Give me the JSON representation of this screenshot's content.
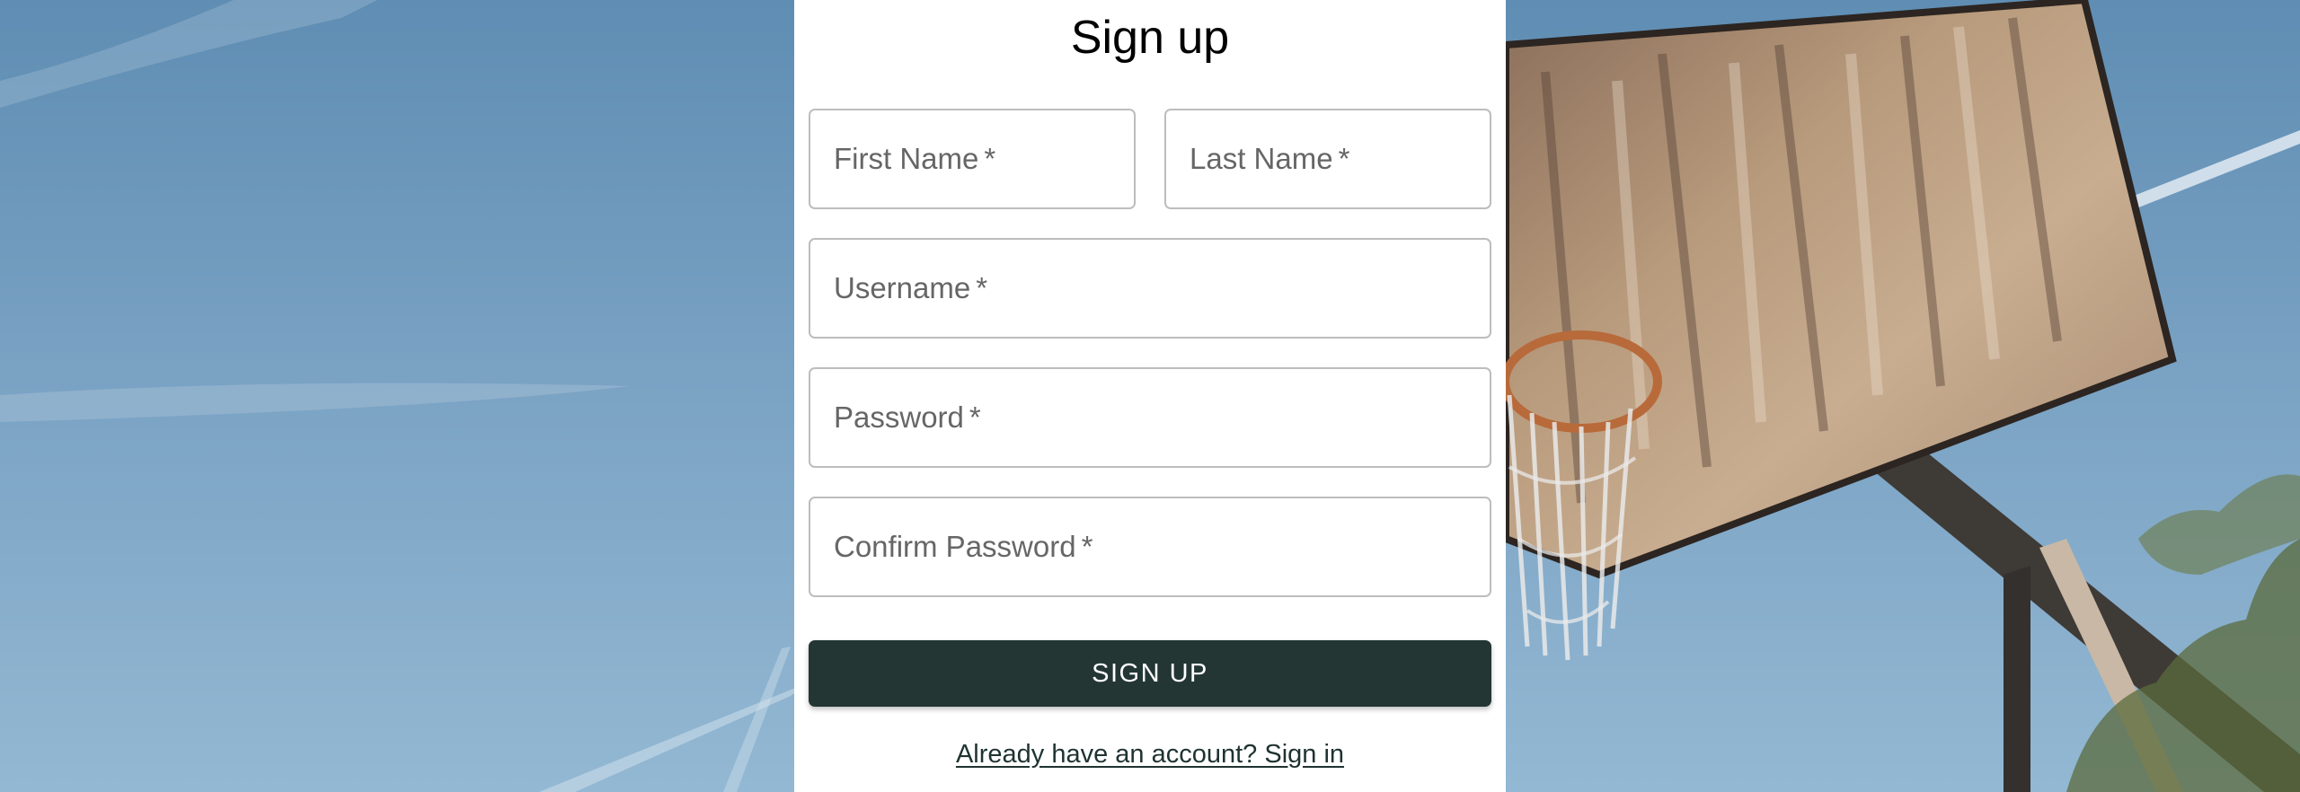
{
  "form": {
    "title": "Sign up",
    "fields": {
      "first_name": {
        "label": "First Name",
        "required_mark": "*",
        "value": ""
      },
      "last_name": {
        "label": "Last Name",
        "required_mark": "*",
        "value": ""
      },
      "username": {
        "label": "Username",
        "required_mark": "*",
        "value": ""
      },
      "password": {
        "label": "Password",
        "required_mark": "*",
        "value": ""
      },
      "confirm_password": {
        "label": "Confirm Password",
        "required_mark": "*",
        "value": ""
      }
    },
    "submit_label": "SIGN UP",
    "signin_link_label": "Already have an account? Sign in"
  },
  "colors": {
    "button_bg": "#233634",
    "button_text": "#ffffff",
    "field_border": "#bdbdbd",
    "label_text": "#666666",
    "sky": "#7ea6c6"
  }
}
